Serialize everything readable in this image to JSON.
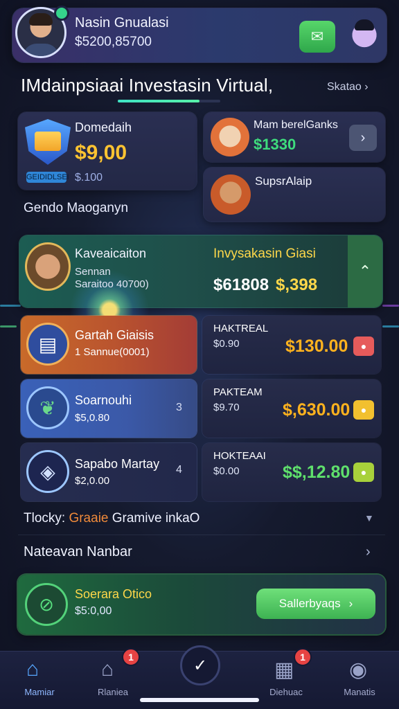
{
  "header": {
    "user_name": "Nasin Gnualasi",
    "balance": "$5200,85700"
  },
  "section": {
    "title": "IMdainpsiaai Investasin Virtual,",
    "see_all": "Skatao"
  },
  "dominant_card": {
    "title": "Domedaih",
    "amount": "$9,00",
    "sub": "$.100",
    "tag": "GEIDIDLSEI"
  },
  "gendo_label": "Gendo Maoganyn",
  "member_card": {
    "name": "Mam berelGanks",
    "amount": "$1330"
  },
  "super_card": {
    "name": "SupsrAlaip"
  },
  "feature": {
    "title": "Kaveaicaiton",
    "sub1": "Sennan",
    "sub2": "Saraitoo 40700)",
    "label": "Invysakasin Giasi",
    "value1": "$61808",
    "value2": "$,398"
  },
  "rows": [
    {
      "title": "Gartah Giaisis",
      "sub": "1 Sannue(0001)",
      "num": "",
      "right_title": "HAKTREAL",
      "right_sub": "$0.90",
      "right_amount": "$130.00",
      "amount_color": "#ffb21e",
      "badge_color": "#e65b5b"
    },
    {
      "title": "Soarnouhi",
      "sub": "$5,0.80",
      "num": "3",
      "right_title": "PAKTEAM",
      "right_sub": "$9.70",
      "right_amount": "$,630.00",
      "amount_color": "#ffb21e",
      "badge_color": "#f2c02f"
    },
    {
      "title": "Sapabo Martay",
      "sub": "$2,0.00",
      "num": "4",
      "right_title": "HOKTEAAI",
      "right_sub": "$0.00",
      "right_amount": "$$,12.80",
      "amount_color": "#5fe06c",
      "badge_color": "#a8d13b"
    }
  ],
  "hint": {
    "prefix": "Tlocky: ",
    "accent": "Graaie",
    "rest": " Gramive inkaO"
  },
  "nav_row_label": "Nateavan Nanbar",
  "promo": {
    "title": "Soerara Otico",
    "sub": "$5:0,00",
    "button_label": "Sallerbyaqs"
  },
  "bottom_nav": {
    "tabs": [
      {
        "label": "Mamiar",
        "badge": ""
      },
      {
        "label": "Rlaniea",
        "badge": "1"
      },
      {
        "label": "Diehuac",
        "badge": "1"
      },
      {
        "label": "Manatis",
        "badge": ""
      }
    ]
  },
  "colors": {
    "accent_gold": "#ffc431",
    "accent_green": "#3edc7d",
    "accent_teal": "#3fe3c5",
    "home_active": "#57a7ff"
  }
}
